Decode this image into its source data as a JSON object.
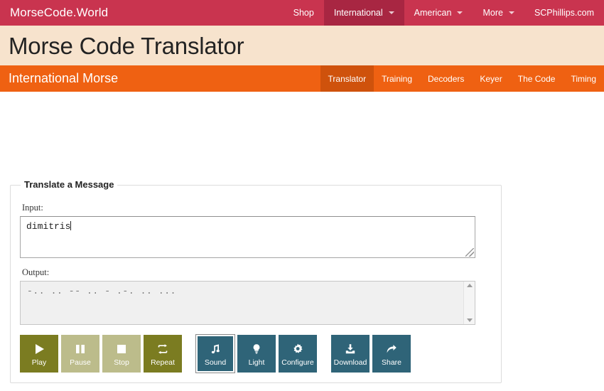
{
  "topbar": {
    "brand": "MorseCode.World",
    "nav": [
      {
        "label": "Shop",
        "has_caret": false,
        "active": false
      },
      {
        "label": "International",
        "has_caret": true,
        "active": true
      },
      {
        "label": "American",
        "has_caret": true,
        "active": false
      },
      {
        "label": "More",
        "has_caret": true,
        "active": false
      },
      {
        "label": "SCPhillips.com",
        "has_caret": false,
        "active": false
      }
    ],
    "background_color": "#c9344f",
    "active_color": "#a82642"
  },
  "titleband": {
    "title": "Morse Code Translator",
    "background_color": "#f7e3cd"
  },
  "subbar": {
    "title": "International Morse",
    "background_color": "#ef6112",
    "active_color": "#cf520c",
    "nav": [
      {
        "label": "Translator",
        "active": true
      },
      {
        "label": "Training",
        "active": false
      },
      {
        "label": "Decoders",
        "active": false
      },
      {
        "label": "Keyer",
        "active": false
      },
      {
        "label": "The Code",
        "active": false
      },
      {
        "label": "Timing",
        "active": false
      }
    ]
  },
  "panel": {
    "legend": "Translate a Message",
    "input": {
      "label": "Input:",
      "value": "dimitris",
      "placeholder": ""
    },
    "output": {
      "label": "Output:",
      "value": "-.. .. -- .. - .-. .. ..."
    }
  },
  "buttons": {
    "playback": [
      {
        "label": "Play",
        "icon": "play-icon",
        "style": "olive",
        "selected": false
      },
      {
        "label": "Pause",
        "icon": "pause-icon",
        "style": "olive-light",
        "selected": false
      },
      {
        "label": "Stop",
        "icon": "stop-icon",
        "style": "olive-light",
        "selected": false
      },
      {
        "label": "Repeat",
        "icon": "repeat-icon",
        "style": "olive",
        "selected": false
      }
    ],
    "modes": [
      {
        "label": "Sound",
        "icon": "music-note-icon",
        "style": "teal",
        "selected": true
      },
      {
        "label": "Light",
        "icon": "lightbulb-icon",
        "style": "teal",
        "selected": false
      },
      {
        "label": "Configure",
        "icon": "gear-icon",
        "style": "teal",
        "selected": false
      }
    ],
    "actions": [
      {
        "label": "Download",
        "icon": "download-icon",
        "style": "teal",
        "selected": false
      },
      {
        "label": "Share",
        "icon": "share-icon",
        "style": "teal",
        "selected": false
      }
    ],
    "colors": {
      "olive": "#7b7c21",
      "olive_light": "#bcbc8b",
      "teal": "#2f6478"
    }
  }
}
